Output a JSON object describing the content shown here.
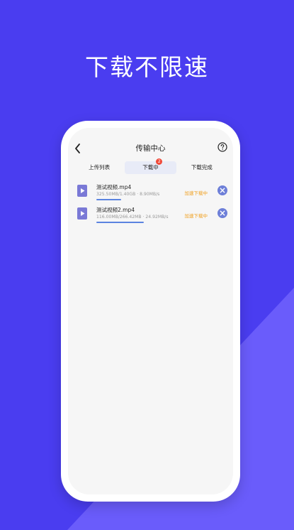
{
  "page": {
    "headline": "下载不限速",
    "colors": {
      "background": "#4a3df0",
      "shape": "#6a5cfb",
      "accent": "#5c84e0",
      "status": "#f0a020",
      "badge": "#f04a3a"
    }
  },
  "app": {
    "title": "传输中心",
    "tabs": [
      {
        "label": "上传列表"
      },
      {
        "label": "下载中",
        "badge": "2"
      },
      {
        "label": "下载完成"
      }
    ],
    "downloads": [
      {
        "name": "测试视频.mp4",
        "stats": "325.50MB/1.40GB · 8.90MB/s",
        "status": "加速下载中",
        "progress": 0.3
      },
      {
        "name": "测试视频2.mp4",
        "stats": "116.00MB/266.42MB · 24.92MB/s",
        "status": "加速下载中",
        "progress": 0.58
      }
    ]
  }
}
